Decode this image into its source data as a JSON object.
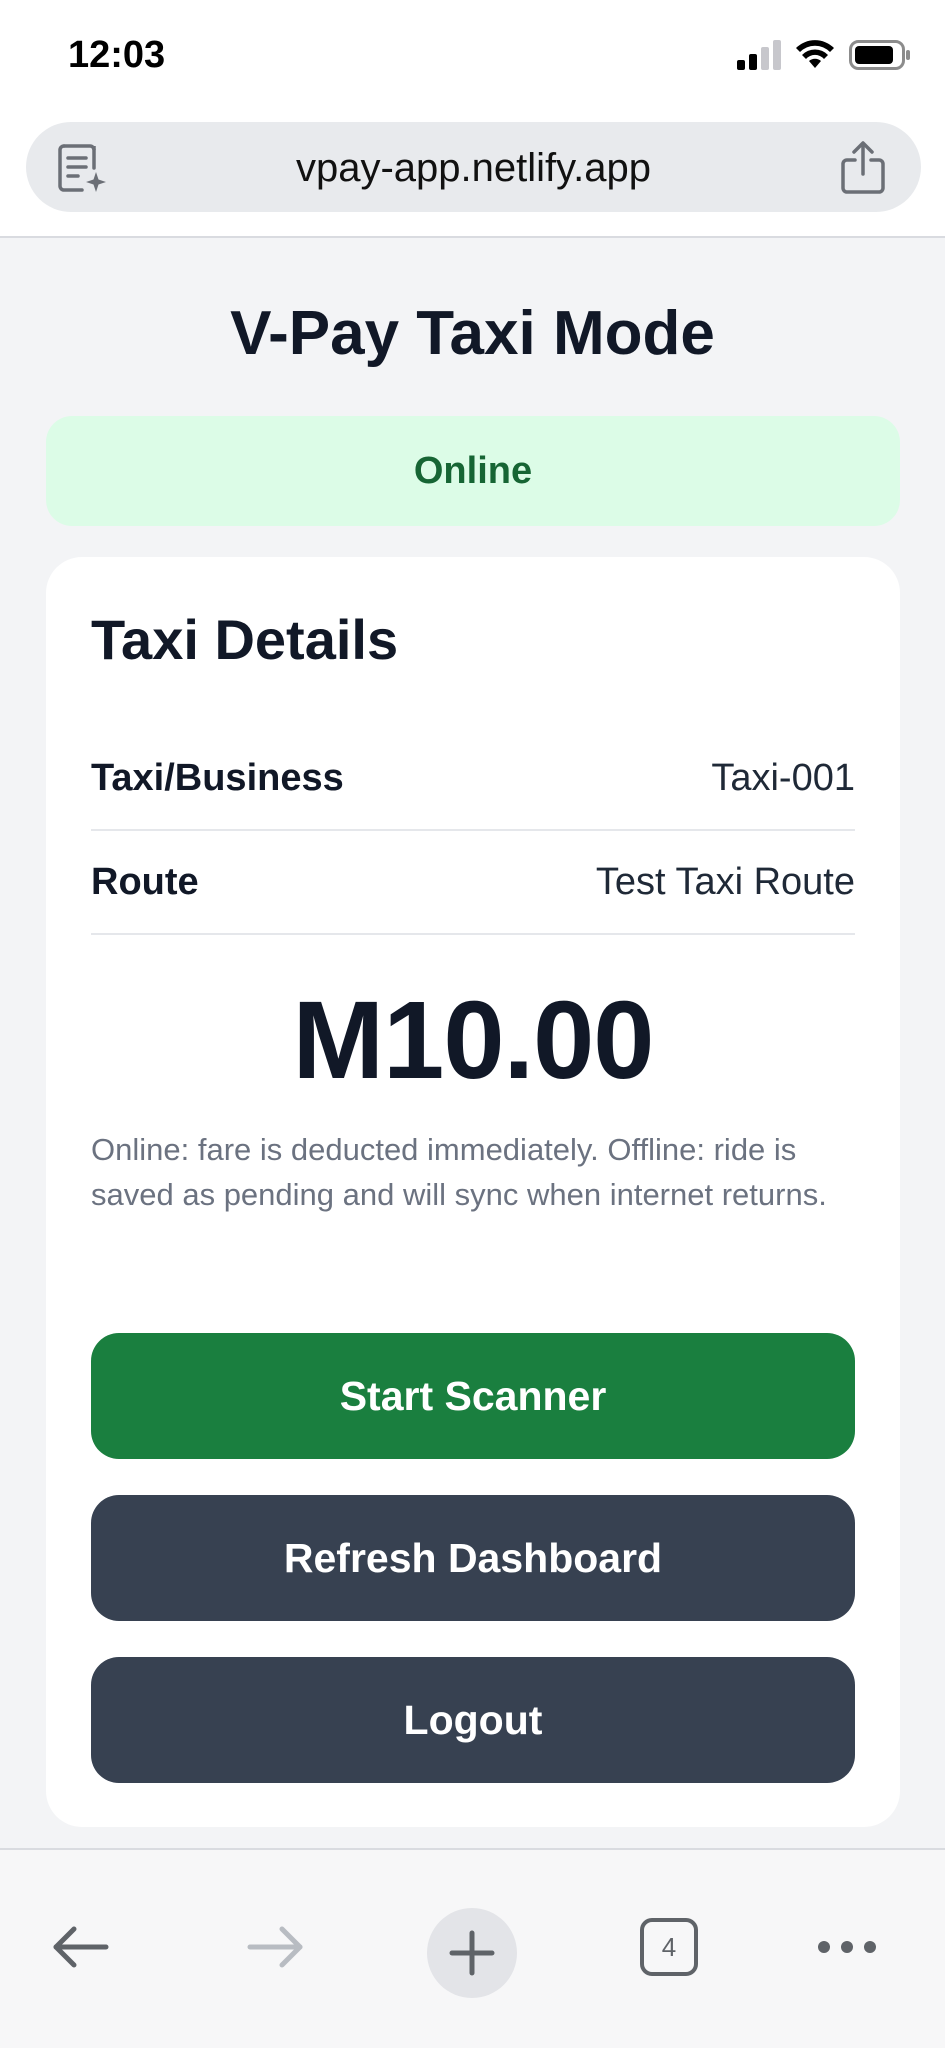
{
  "status_bar": {
    "time": "12:03",
    "icons": [
      "signal-icon",
      "wifi-icon",
      "battery-icon"
    ]
  },
  "browser": {
    "url": "vpay-app.netlify.app",
    "left_icon": "reader-icon",
    "right_icon": "share-icon",
    "toolbar": {
      "icons": [
        "back-arrow-icon",
        "forward-arrow-icon",
        "plus-icon",
        "tabs-icon",
        "more-icon"
      ],
      "tab_count": "4"
    }
  },
  "page": {
    "title": "V-Pay Taxi Mode",
    "status_banner": "Online",
    "card": {
      "title": "Taxi Details",
      "rows": [
        {
          "label": "Taxi/Business",
          "value": "Taxi-001"
        },
        {
          "label": "Route",
          "value": "Test Taxi Route"
        }
      ],
      "fare": "M10.00",
      "note": "Online: fare is deducted immediately. Offline: ride is saved as pending and will sync when internet returns.",
      "buttons": {
        "start_scanner": "Start Scanner",
        "refresh_dashboard": "Refresh Dashboard",
        "logout": "Logout"
      }
    }
  },
  "colors": {
    "primary_green": "#1a7f3f",
    "dark_button": "#374151",
    "online_bg": "#dcfce7",
    "online_text": "#166534"
  }
}
